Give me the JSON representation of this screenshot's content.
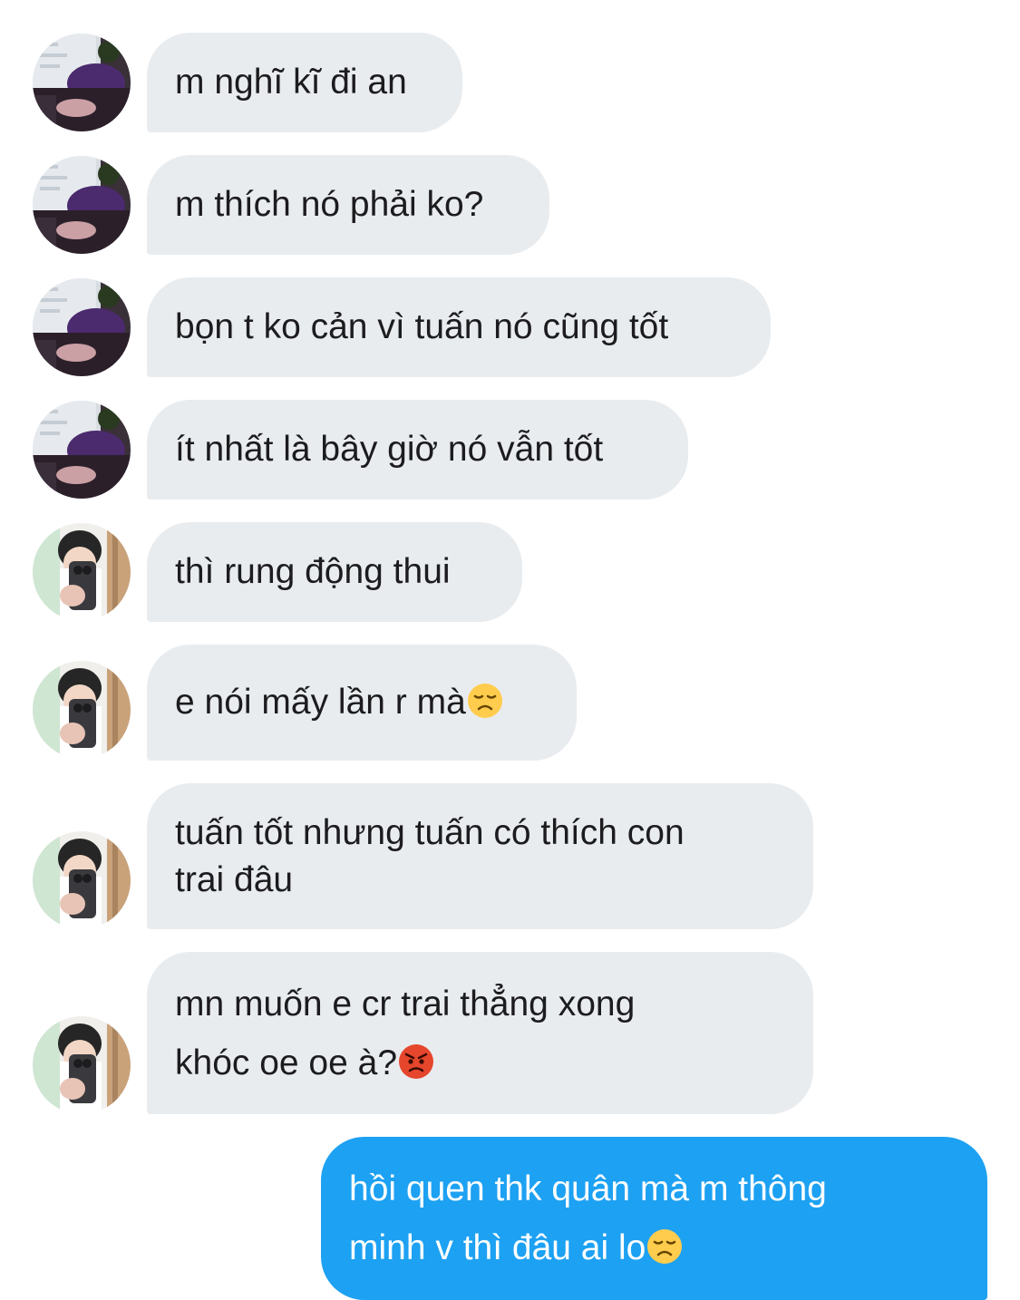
{
  "conversation": {
    "messages": [
      {
        "sender": "friend",
        "avatar": "friend-avatar",
        "lines": [
          "m nghĩ kĩ đi an"
        ]
      },
      {
        "sender": "friend",
        "avatar": "friend-avatar",
        "lines": [
          "m thích nó phải ko?"
        ]
      },
      {
        "sender": "friend",
        "avatar": "friend-avatar",
        "lines": [
          "bọn t ko cản vì tuấn nó cũng tốt"
        ]
      },
      {
        "sender": "friend",
        "avatar": "friend-avatar",
        "lines": [
          "ít nhất là bây giờ nó vẫn tốt"
        ]
      },
      {
        "sender": "user",
        "avatar": "user-avatar",
        "lines": [
          "thì rung động thui"
        ]
      },
      {
        "sender": "user",
        "avatar": "user-avatar",
        "lines": [
          "e nói mấy lần r mà"
        ],
        "emoji": "disappointed-face"
      },
      {
        "sender": "user",
        "avatar": "user-avatar",
        "lines": [
          "tuấn tốt nhưng tuấn có thích con",
          "trai đâu"
        ]
      },
      {
        "sender": "user",
        "avatar": "user-avatar",
        "lines": [
          "mn muốn e cr trai thẳng xong",
          "khóc oe oe à?"
        ],
        "emoji": "angry-face"
      },
      {
        "sender": "me",
        "lines": [
          "hồi quen thk quân mà m thông",
          "minh v thì đâu ai lo"
        ],
        "emoji": "disappointed-face"
      }
    ]
  },
  "colors": {
    "received_bubble": "#e9ecef",
    "sent_bubble": "#1da1f2",
    "received_text": "#1c1c1e",
    "sent_text": "#ffffff"
  }
}
